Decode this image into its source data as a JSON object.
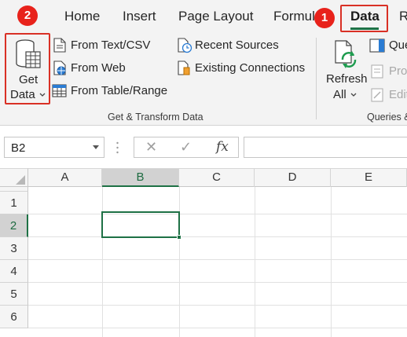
{
  "tabs": [
    {
      "label": "Home"
    },
    {
      "label": "Insert"
    },
    {
      "label": "Page Layout"
    },
    {
      "label": "Formul"
    },
    {
      "label": "Data"
    },
    {
      "label": "R"
    }
  ],
  "ribbon": {
    "get_transform": {
      "get_data_line1": "Get",
      "get_data_line2": "Data",
      "from_text_csv": "From Text/CSV",
      "from_web": "From Web",
      "from_table_range": "From Table/Range",
      "recent_sources": "Recent Sources",
      "existing_connections": "Existing Connections",
      "group_label": "Get & Transform Data"
    },
    "queries": {
      "refresh_line1": "Refresh",
      "refresh_line2": "All",
      "queries_item": "Que",
      "properties_item": "Pro",
      "edit_links_item": "Edit",
      "group_label": "Queries &"
    }
  },
  "callouts": {
    "badge_1": "1",
    "badge_2": "2"
  },
  "formula_bar": {
    "name_box_value": "B2",
    "cancel_glyph": "✕",
    "enter_glyph": "✓",
    "fx_label": "fx",
    "formula_value": ""
  },
  "grid": {
    "columns": [
      "A",
      "B",
      "C",
      "D",
      "E"
    ],
    "rows": [
      "1",
      "2",
      "3",
      "4",
      "5",
      "6"
    ],
    "active_column": "B",
    "active_row": "2"
  },
  "colors": {
    "accent_green": "#1e7145",
    "callout_red": "#e8221b"
  }
}
